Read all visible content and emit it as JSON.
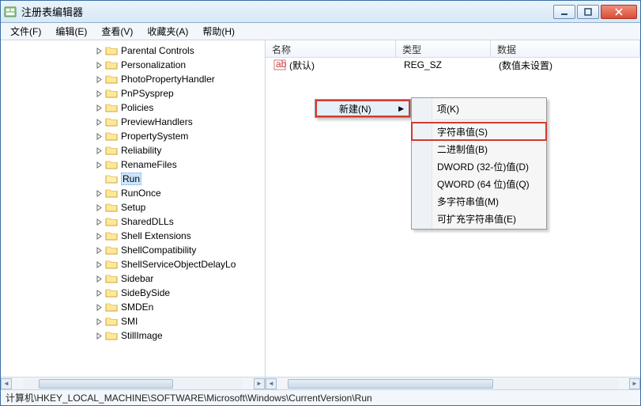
{
  "title": "注册表编辑器",
  "menu": {
    "file": "文件(F)",
    "edit": "编辑(E)",
    "view": "查看(V)",
    "favorites": "收藏夹(A)",
    "help": "帮助(H)"
  },
  "tree": {
    "items": [
      {
        "label": "Parental Controls"
      },
      {
        "label": "Personalization"
      },
      {
        "label": "PhotoPropertyHandler"
      },
      {
        "label": "PnPSysprep"
      },
      {
        "label": "Policies"
      },
      {
        "label": "PreviewHandlers"
      },
      {
        "label": "PropertySystem"
      },
      {
        "label": "Reliability"
      },
      {
        "label": "RenameFiles"
      },
      {
        "label": "Run",
        "selected": true,
        "noexpander": true
      },
      {
        "label": "RunOnce"
      },
      {
        "label": "Setup"
      },
      {
        "label": "SharedDLLs"
      },
      {
        "label": "Shell Extensions"
      },
      {
        "label": "ShellCompatibility"
      },
      {
        "label": "ShellServiceObjectDelayLo"
      },
      {
        "label": "Sidebar"
      },
      {
        "label": "SideBySide"
      },
      {
        "label": "SMDEn"
      },
      {
        "label": "SMI"
      },
      {
        "label": "StillImage"
      }
    ]
  },
  "list": {
    "headers": {
      "name": "名称",
      "type": "类型",
      "data": "数据"
    },
    "rows": [
      {
        "name": "(默认)",
        "type": "REG_SZ",
        "data": "(数值未设置)"
      }
    ]
  },
  "context_menu": {
    "parent_label": "新建(N)",
    "children": [
      {
        "label": "项(K)",
        "sep_after": true
      },
      {
        "label": "字符串值(S)",
        "highlight": true
      },
      {
        "label": "二进制值(B)"
      },
      {
        "label": "DWORD (32-位)值(D)"
      },
      {
        "label": "QWORD (64 位)值(Q)"
      },
      {
        "label": "多字符串值(M)"
      },
      {
        "label": "可扩充字符串值(E)"
      }
    ]
  },
  "statusbar": "计算机\\HKEY_LOCAL_MACHINE\\SOFTWARE\\Microsoft\\Windows\\CurrentVersion\\Run"
}
